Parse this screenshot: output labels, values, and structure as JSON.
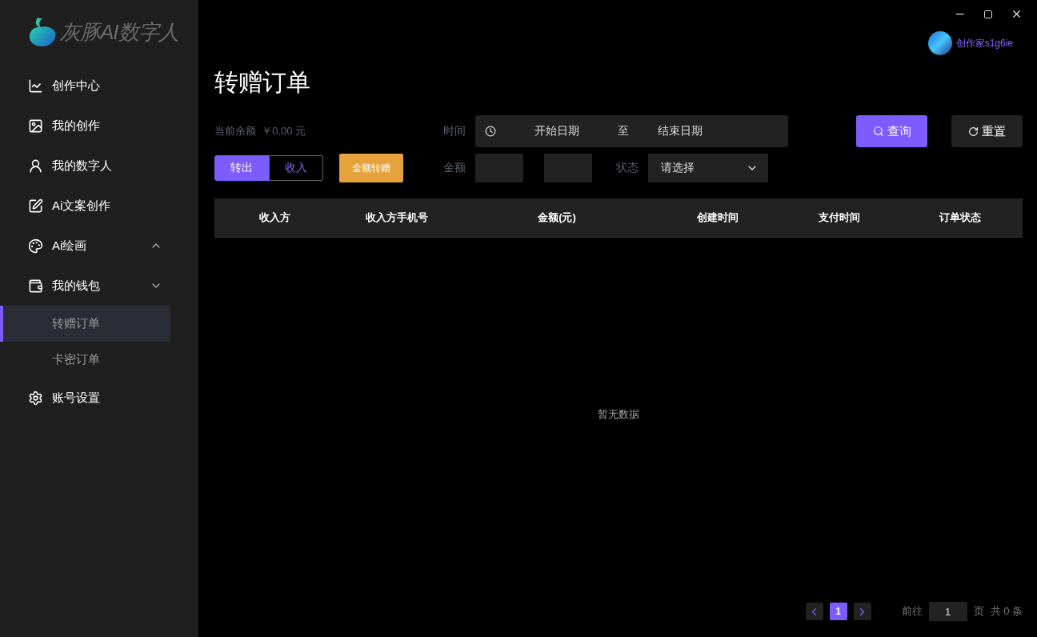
{
  "logo": {
    "text": "灰豚AI数字人"
  },
  "sidebar": {
    "items": [
      {
        "kind": "item",
        "label": "创作中心"
      },
      {
        "kind": "item",
        "label": "我的创作"
      },
      {
        "kind": "item",
        "label": "我的数字人"
      },
      {
        "kind": "item",
        "label": "Ai文案创作"
      },
      {
        "kind": "group",
        "label": "Ai绘画",
        "expanded": false
      },
      {
        "kind": "group",
        "label": "我的钱包",
        "expanded": true,
        "children": [
          {
            "label": "转赠订单",
            "selected": true
          },
          {
            "label": "卡密订单",
            "selected": false
          }
        ]
      },
      {
        "kind": "item",
        "label": "账号设置"
      }
    ]
  },
  "user": {
    "name": "创作家s1g6ie"
  },
  "page_title": "转赠订单",
  "balance": {
    "label": "当前余额",
    "value": "￥0.00 元"
  },
  "direction_tabs": [
    {
      "label": "转出",
      "selected": true
    },
    {
      "label": "收入",
      "selected": false
    }
  ],
  "transfer_button": "金额转赠",
  "filters": {
    "time_label": "时间",
    "start_placeholder": "开始日期",
    "separator": "至",
    "end_placeholder": "结束日期",
    "amount_label": "金额",
    "status_label": "状态",
    "status_placeholder": "请选择"
  },
  "buttons": [
    {
      "kind": "primary",
      "label": "查询"
    },
    {
      "kind": "secondary",
      "label": "重置"
    }
  ],
  "table": {
    "columns": [
      "收入方",
      "收入方手机号",
      "金额(元)",
      "创建时间",
      "支付时间",
      "订单状态"
    ],
    "empty_text": "暂无数据"
  },
  "pagination": {
    "pages": [
      {
        "label": "1",
        "selected": true
      }
    ],
    "goto_label": "前往",
    "goto_value": "1",
    "page_unit": "页",
    "total": "共 0 条"
  }
}
